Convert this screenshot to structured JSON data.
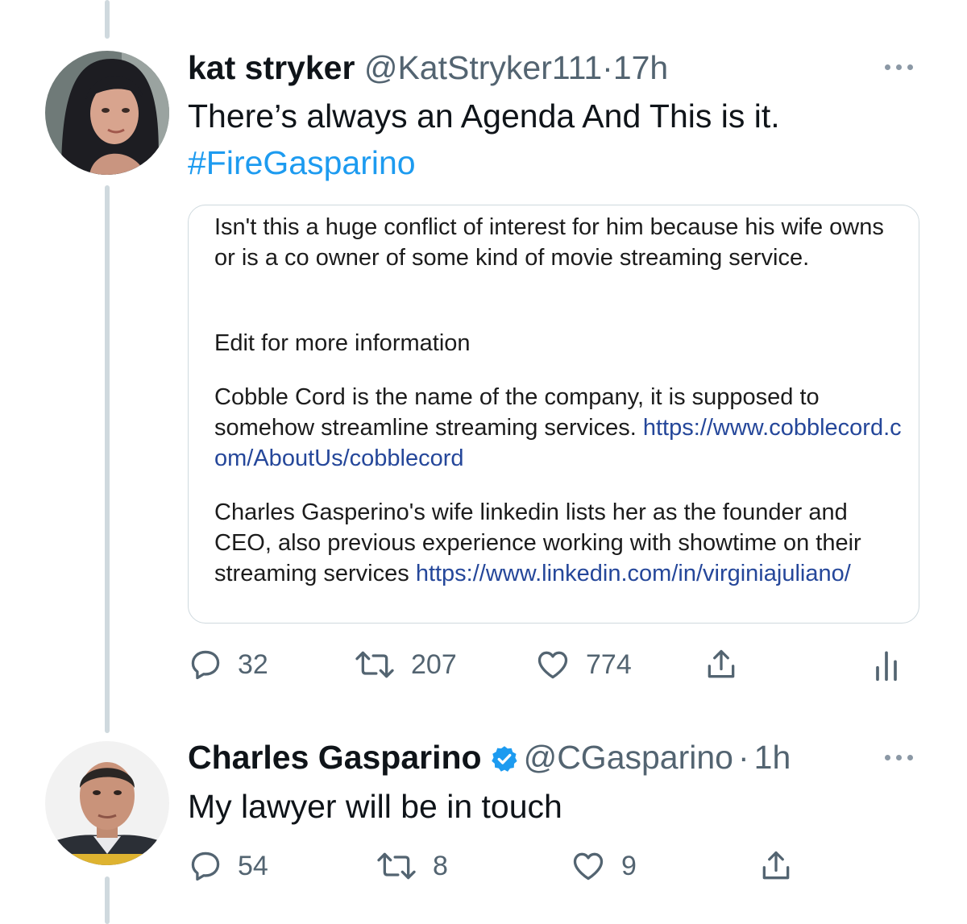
{
  "tweet1": {
    "display_name": "kat stryker",
    "handle": "@KatStryker111",
    "separator": "·",
    "time": "17h",
    "text": "There’s always an Agenda And This is it.",
    "hashtag": "#FireGasparino",
    "quote": {
      "p1": "Isn't this a huge conflict of interest for him because his wife owns or is a co owner of some kind of movie streaming service.",
      "p2": "Edit for more information",
      "p3_text": "Cobble Cord is the name of the company, it is supposed to somehow streamline streaming services.",
      "p3_link": "https://www.cobblecord.com/AboutUs/cobblecord",
      "p4_text": "Charles Gasperino's wife linkedin lists her as the founder and CEO, also previous experience working with showtime on their streaming services",
      "p4_link": "https://www.linkedin.com/in/virginiajuliano/"
    },
    "replies": "32",
    "retweets": "207",
    "likes": "774"
  },
  "tweet2": {
    "display_name": "Charles Gasparino",
    "handle": "@CGasparino",
    "separator": "·",
    "time": "1h",
    "text": "My lawyer will be in touch",
    "replies": "54",
    "retweets": "8",
    "likes": "9"
  },
  "icons": {
    "reply": "reply-icon",
    "retweet": "retweet-icon",
    "like": "heart-icon",
    "share": "share-icon",
    "analytics": "analytics-icon",
    "more": "more-icon",
    "verified": "verified-badge-icon"
  },
  "colors": {
    "hashtag": "#1d9bf0",
    "quote_link": "#25479a",
    "muted": "#536471",
    "thread_line": "#cfd9de",
    "verified": "#1d9bf0"
  }
}
